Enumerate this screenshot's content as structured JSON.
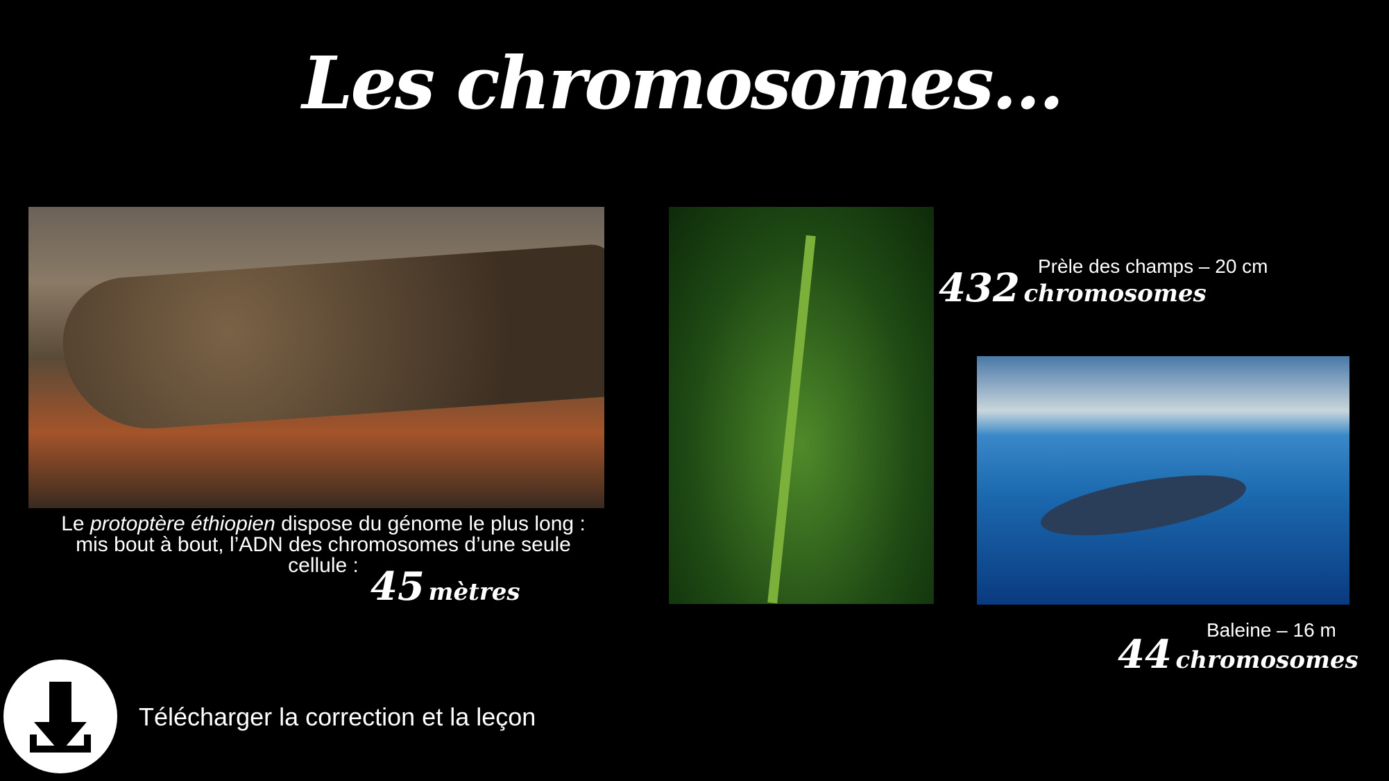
{
  "title": "Les chromosomes…",
  "fish": {
    "caption_prefix": "Le ",
    "caption_species": "protoptère éthiopien",
    "caption_rest_1": " dispose du génome le plus long :",
    "caption_line_2": "mis bout à bout, l’ADN des chromosomes d’une seule",
    "caption_line_3": "cellule :",
    "highlight_number": "45",
    "highlight_unit": "mètres"
  },
  "plant": {
    "label": "Prèle des champs – 20 cm",
    "number": "432",
    "unit": "chromosomes"
  },
  "whale": {
    "label": "Baleine – 16 m",
    "number": "44",
    "unit": "chromosomes"
  },
  "download": {
    "icon": "download-icon",
    "label": "Télécharger la correction et la leçon"
  }
}
